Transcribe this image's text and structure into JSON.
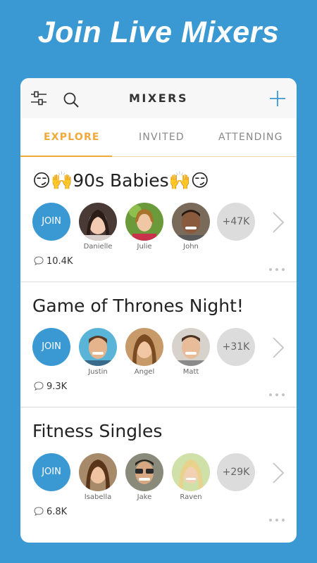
{
  "headline": "Join Live Mixers",
  "topbar": {
    "title": "MIXERS",
    "icons": [
      "filter-icon",
      "search-icon",
      "plus-icon"
    ],
    "accent": "#3a98d2"
  },
  "tabs": [
    {
      "label": "EXPLORE",
      "active": true
    },
    {
      "label": "INVITED",
      "active": false
    },
    {
      "label": "ATTENDING",
      "active": false
    }
  ],
  "mixers": [
    {
      "title": "😏🙌90s Babies🙌😏",
      "join_label": "JOIN",
      "people": [
        "Danielle",
        "Julie",
        "John"
      ],
      "more": "+47K",
      "comments": "10.4K"
    },
    {
      "title": "Game of Thrones Night!",
      "join_label": "JOIN",
      "people": [
        "Justin",
        "Angel",
        "Matt"
      ],
      "more": "+31K",
      "comments": "9.3K"
    },
    {
      "title": "Fitness Singles",
      "join_label": "JOIN",
      "people": [
        "Isabella",
        "Jake",
        "Raven"
      ],
      "more": "+29K",
      "comments": "6.8K"
    }
  ],
  "colors": {
    "background": "#3a98d2",
    "join": "#3a98d2",
    "active_tab": "#f0a93a"
  }
}
